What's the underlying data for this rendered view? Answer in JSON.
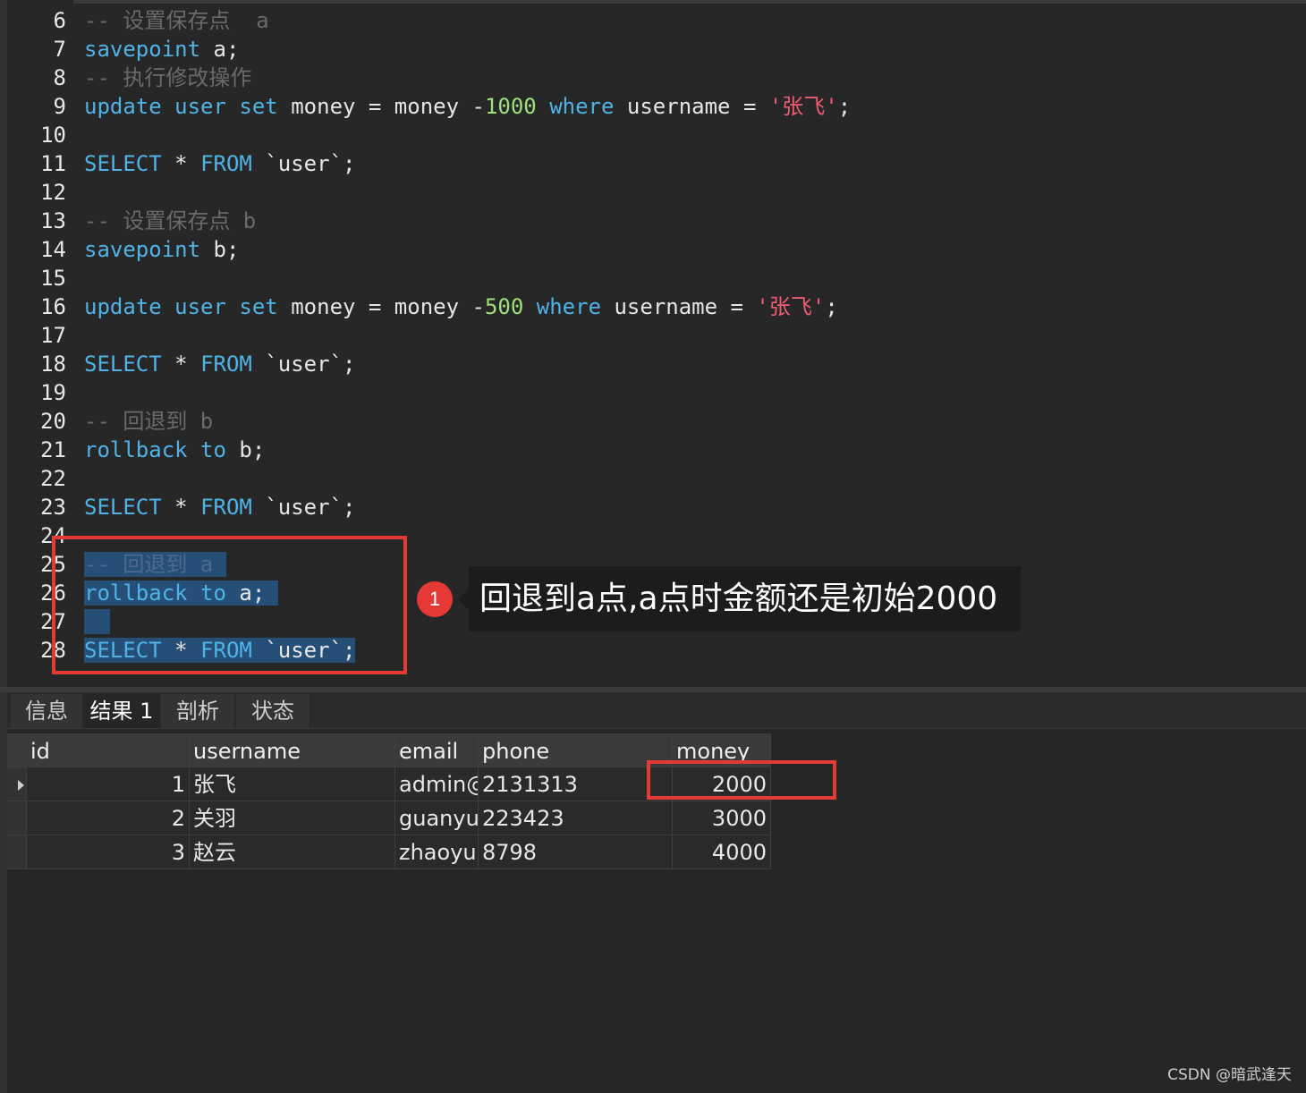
{
  "editor": {
    "lines": [
      {
        "no": "6",
        "tokens": [
          {
            "t": "-- 设置保存点  a",
            "c": "cm"
          }
        ]
      },
      {
        "no": "7",
        "tokens": [
          {
            "t": "savepoint",
            "c": "kw"
          },
          {
            "t": " a;",
            "c": ""
          }
        ]
      },
      {
        "no": "8",
        "tokens": [
          {
            "t": "-- 执行修改操作",
            "c": "cm"
          }
        ]
      },
      {
        "no": "9",
        "tokens": [
          {
            "t": "update",
            "c": "kw"
          },
          {
            "t": " ",
            "c": ""
          },
          {
            "t": "user",
            "c": "kw"
          },
          {
            "t": " ",
            "c": ""
          },
          {
            "t": "set",
            "c": "kw"
          },
          {
            "t": " money = money -",
            "c": ""
          },
          {
            "t": "1000",
            "c": "num"
          },
          {
            "t": " ",
            "c": ""
          },
          {
            "t": "where",
            "c": "kw"
          },
          {
            "t": " username = ",
            "c": ""
          },
          {
            "t": "'张飞'",
            "c": "str"
          },
          {
            "t": ";",
            "c": ""
          }
        ]
      },
      {
        "no": "10",
        "tokens": []
      },
      {
        "no": "11",
        "tokens": [
          {
            "t": "SELECT",
            "c": "kw"
          },
          {
            "t": " * ",
            "c": ""
          },
          {
            "t": "FROM",
            "c": "kw"
          },
          {
            "t": " `user`;",
            "c": ""
          }
        ]
      },
      {
        "no": "12",
        "tokens": []
      },
      {
        "no": "13",
        "tokens": [
          {
            "t": "-- 设置保存点 b",
            "c": "cm"
          }
        ]
      },
      {
        "no": "14",
        "tokens": [
          {
            "t": "savepoint",
            "c": "kw"
          },
          {
            "t": " b;",
            "c": ""
          }
        ]
      },
      {
        "no": "15",
        "tokens": []
      },
      {
        "no": "16",
        "tokens": [
          {
            "t": "update",
            "c": "kw"
          },
          {
            "t": " ",
            "c": ""
          },
          {
            "t": "user",
            "c": "kw"
          },
          {
            "t": " ",
            "c": ""
          },
          {
            "t": "set",
            "c": "kw"
          },
          {
            "t": " money = money -",
            "c": ""
          },
          {
            "t": "500",
            "c": "num"
          },
          {
            "t": " ",
            "c": ""
          },
          {
            "t": "where",
            "c": "kw"
          },
          {
            "t": " username = ",
            "c": ""
          },
          {
            "t": "'张飞'",
            "c": "str"
          },
          {
            "t": ";",
            "c": ""
          }
        ]
      },
      {
        "no": "17",
        "tokens": []
      },
      {
        "no": "18",
        "tokens": [
          {
            "t": "SELECT",
            "c": "kw"
          },
          {
            "t": " * ",
            "c": ""
          },
          {
            "t": "FROM",
            "c": "kw"
          },
          {
            "t": " `user`;",
            "c": ""
          }
        ]
      },
      {
        "no": "19",
        "tokens": []
      },
      {
        "no": "20",
        "tokens": [
          {
            "t": "-- 回退到 b",
            "c": "cm"
          }
        ]
      },
      {
        "no": "21",
        "tokens": [
          {
            "t": "rollback",
            "c": "kw"
          },
          {
            "t": " ",
            "c": ""
          },
          {
            "t": "to",
            "c": "kw"
          },
          {
            "t": " b;",
            "c": ""
          }
        ]
      },
      {
        "no": "22",
        "tokens": []
      },
      {
        "no": "23",
        "tokens": [
          {
            "t": "SELECT",
            "c": "kw"
          },
          {
            "t": " * ",
            "c": ""
          },
          {
            "t": "FROM",
            "c": "kw"
          },
          {
            "t": " `user`;",
            "c": ""
          }
        ]
      },
      {
        "no": "24",
        "tokens": []
      },
      {
        "no": "25",
        "tokens": [
          {
            "t": "-- 回退到 a ",
            "c": "sel-cm"
          }
        ],
        "selected": true
      },
      {
        "no": "26",
        "tokens": [
          {
            "t": "rollback",
            "c": "kw"
          },
          {
            "t": " ",
            "c": ""
          },
          {
            "t": "to",
            "c": "kw"
          },
          {
            "t": " a; ",
            "c": ""
          }
        ],
        "selected": true
      },
      {
        "no": "27",
        "tokens": [
          {
            "t": "  ",
            "c": ""
          }
        ],
        "selected": true
      },
      {
        "no": "28",
        "tokens": [
          {
            "t": "SELECT",
            "c": "kw"
          },
          {
            "t": " * ",
            "c": ""
          },
          {
            "t": "FROM",
            "c": "kw"
          },
          {
            "t": " `user`;",
            "c": ""
          }
        ],
        "selected": true
      }
    ]
  },
  "annotation": {
    "badge": "1",
    "text": "回退到a点,a点时金额还是初始2000"
  },
  "tabs": [
    {
      "label": "信息",
      "active": false
    },
    {
      "label": "结果 1",
      "active": true
    },
    {
      "label": "剖析",
      "active": false
    },
    {
      "label": "状态",
      "active": false
    }
  ],
  "result_grid": {
    "columns": [
      "id",
      "username",
      "email",
      "phone",
      "money"
    ],
    "rows": [
      [
        "1",
        "张飞",
        "admin@",
        "2131313",
        "2000"
      ],
      [
        "2",
        "关羽",
        "guanyu",
        "223423",
        "3000"
      ],
      [
        "3",
        "赵云",
        "zhaoyun",
        "8798",
        "4000"
      ]
    ]
  },
  "watermark": "CSDN @暗武逢天",
  "colors": {
    "keyword": "#4fb3e8",
    "comment": "#6a6a6a",
    "number": "#9ee07a",
    "string": "#ef5b6f",
    "selection": "#264f78",
    "highlight_box": "#e53935"
  }
}
